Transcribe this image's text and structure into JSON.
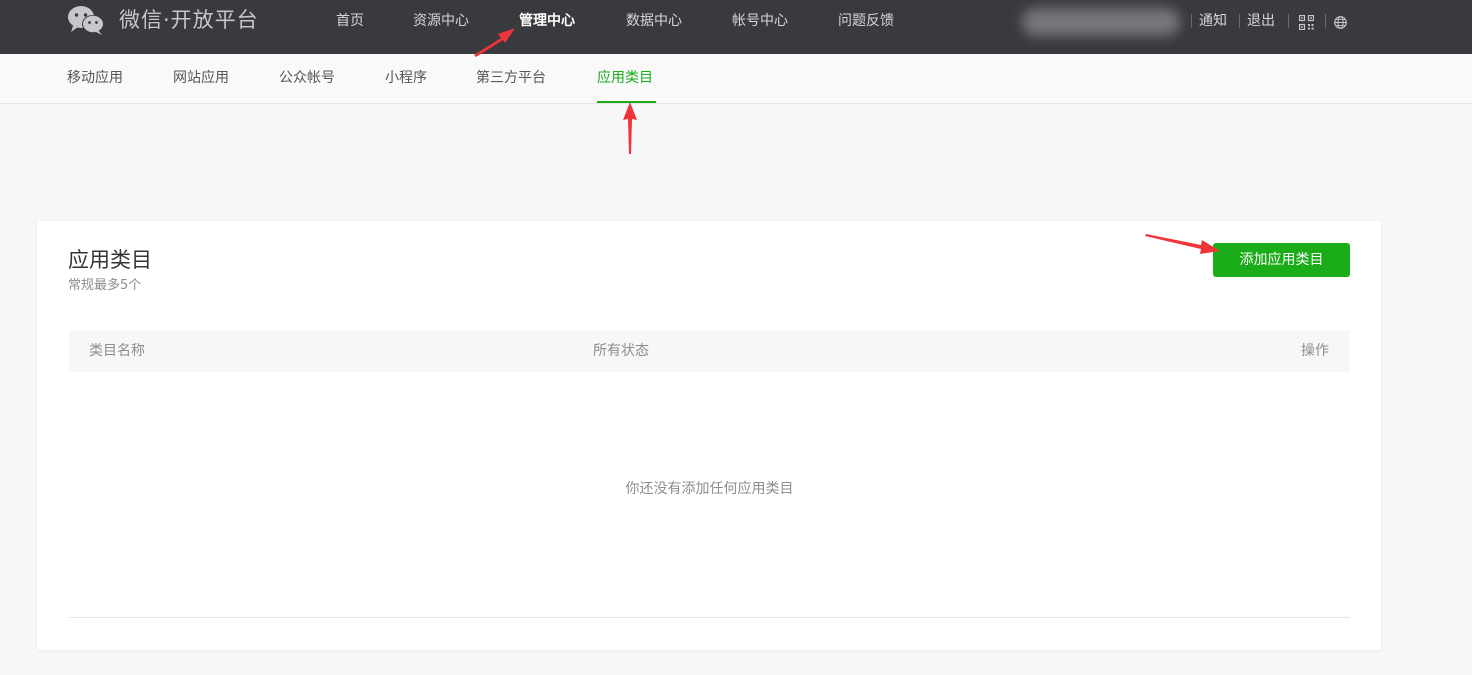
{
  "header": {
    "brand": "微信·开放平台",
    "nav": [
      {
        "label": "首页"
      },
      {
        "label": "资源中心"
      },
      {
        "label": "管理中心",
        "active": true
      },
      {
        "label": "数据中心"
      },
      {
        "label": "帐号中心"
      },
      {
        "label": "问题反馈"
      }
    ],
    "right_links": {
      "notify": "通知",
      "logout": "退出"
    },
    "icons": [
      "wechat-logo-icon",
      "qrcode-icon",
      "globe-icon"
    ]
  },
  "subnav": {
    "items": [
      {
        "label": "移动应用"
      },
      {
        "label": "网站应用"
      },
      {
        "label": "公众帐号"
      },
      {
        "label": "小程序"
      },
      {
        "label": "第三方平台"
      },
      {
        "label": "应用类目",
        "active": true
      }
    ]
  },
  "card": {
    "title": "应用类目",
    "subtitle": "常规最多5个",
    "add_button": "添加应用类目",
    "table_headers": {
      "name": "类目名称",
      "status": "所有状态",
      "action": "操作"
    },
    "empty_text": "你还没有添加任何应用类目"
  },
  "colors": {
    "accent": "#1aad19",
    "header_bg": "#393a3e",
    "annotation_arrow": "#f0353a"
  }
}
